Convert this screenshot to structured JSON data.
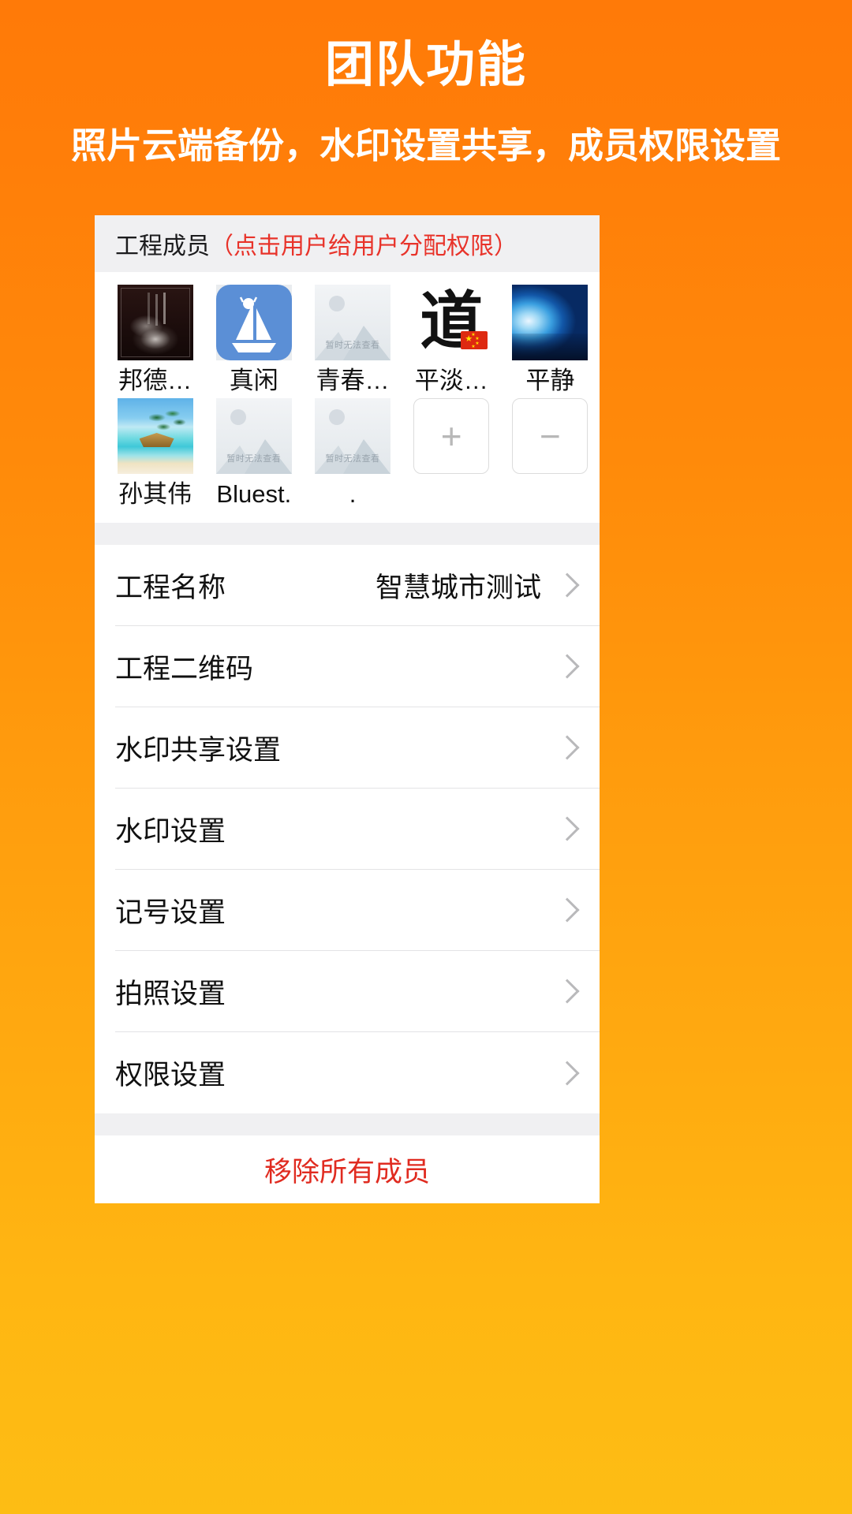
{
  "promo": {
    "title": "团队功能",
    "subtitle": "照片云端备份，水印设置共享，成员权限设置",
    "title_color": "#ffffff",
    "bg_top_color": "#FF7A08",
    "bg_bottom_color": "#FDBD14"
  },
  "members_section": {
    "header_label": "工程成员",
    "header_hint": "（点击用户给用户分配权限）",
    "header_hint_color": "#e8332a",
    "placeholder_text": "暂时无法查看",
    "members": [
      {
        "name": "邦德…",
        "avatar": "book-photo-avatar"
      },
      {
        "name": "真闲",
        "avatar": "sailboat-icon-avatar"
      },
      {
        "name": "青春…",
        "avatar": "broken-image-placeholder-avatar"
      },
      {
        "name": "平淡…",
        "avatar": "dao-calligraphy-avatar"
      },
      {
        "name": "平静",
        "avatar": "wave-photo-avatar"
      },
      {
        "name": "孙其伟",
        "avatar": "beach-photo-avatar"
      },
      {
        "name": "Bluest.",
        "avatar": "broken-image-placeholder-avatar"
      },
      {
        "name": ".",
        "avatar": "broken-image-placeholder-avatar"
      }
    ],
    "add_button_label": "+",
    "remove_button_label": "−"
  },
  "settings": {
    "rows": [
      {
        "label": "工程名称",
        "value": "智慧城市测试"
      },
      {
        "label": "工程二维码",
        "value": ""
      },
      {
        "label": "水印共享设置",
        "value": ""
      },
      {
        "label": "水印设置",
        "value": ""
      },
      {
        "label": "记号设置",
        "value": ""
      },
      {
        "label": "拍照设置",
        "value": ""
      },
      {
        "label": "权限设置",
        "value": ""
      }
    ]
  },
  "footer": {
    "remove_all_label": "移除所有成员",
    "remove_all_color": "#e02b20"
  }
}
